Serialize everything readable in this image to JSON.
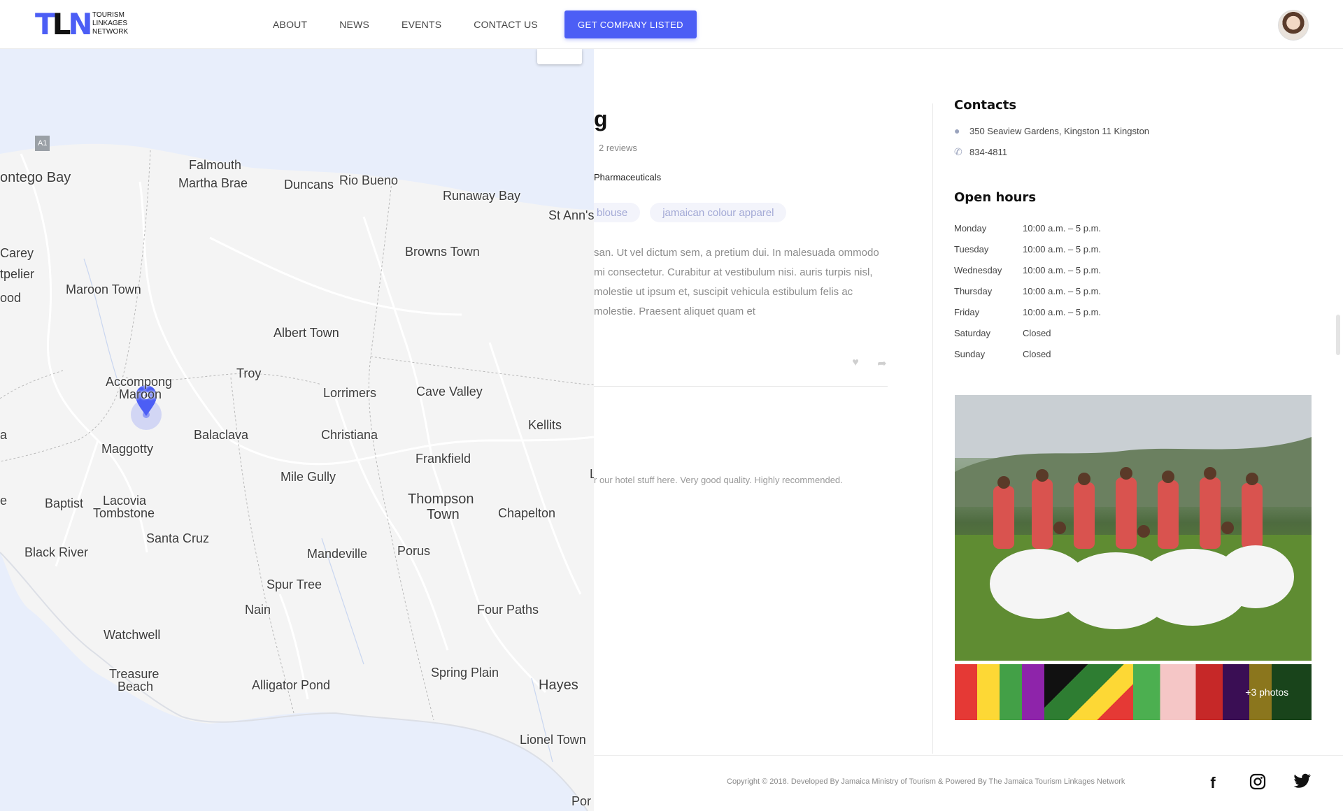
{
  "header": {
    "logo_mark": {
      "t": "T",
      "l": "L",
      "n": "N"
    },
    "logo_text": [
      "TOURISM",
      "LINKAGES",
      "NETWORK"
    ],
    "nav": [
      "ABOUT",
      "NEWS",
      "EVENTS",
      "CONTACT US"
    ],
    "cta": "GET COMPANY LISTED"
  },
  "map": {
    "route_badge": "A1",
    "labels": [
      "ontego Bay",
      "Falmouth",
      "Martha Brae",
      "Duncans",
      "Rio Bueno",
      "Runaway Bay",
      "St Ann's",
      "Carey",
      "tpelier",
      "ood",
      "Maroon Town",
      "Browns Town",
      "Albert Town",
      "Troy",
      "Accompong",
      "Maroon",
      "Lorrimers",
      "Cave Valley",
      "Kellits",
      "Balaclava",
      "Christiana",
      "Maggotty",
      "Frankfield",
      "Mile Gully",
      "Baptist",
      "Lacovia",
      "Tombstone",
      "Thompson",
      "Town",
      "Chapelton",
      "Santa Cruz",
      "Black River",
      "Mandeville",
      "Porus",
      "Spur Tree",
      "Nain",
      "Four Paths",
      "Watchwell",
      "Treasure",
      "Beach",
      "Alligator Pond",
      "Spring Plain",
      "Hayes",
      "Lionel Town",
      "Por",
      "a",
      "e",
      "L"
    ],
    "colors": {
      "water": "#e8eefb",
      "land": "#f4f4f4",
      "marker": "#4c5ef5"
    }
  },
  "listing": {
    "title_fragment": "g",
    "reviews": "2 reviews",
    "category": "Pharmaceuticals",
    "tags": [
      "blouse",
      "jamaican colour apparel"
    ],
    "description": "san. Ut vel dictum sem, a pretium dui. In malesuada ommodo mi consectetur. Curabitur at vestibulum nisi. auris turpis nisl, molestie ut ipsum et, suscipit vehicula estibulum felis ac molestie. Praesent aliquet quam et",
    "review_text": "r our hotel stuff here. Very good quality. Highly recommended."
  },
  "sidebar": {
    "contacts_heading": "Contacts",
    "address": "350 Seaview Gardens, Kingston 11 Kingston",
    "phone": "834-4811",
    "hours_heading": "Open hours",
    "hours": [
      {
        "day": "Monday",
        "time": "10:00 a.m. – 5 p.m."
      },
      {
        "day": "Tuesday",
        "time": "10:00 a.m. – 5 p.m."
      },
      {
        "day": "Wednesday",
        "time": "10:00 a.m. – 5 p.m."
      },
      {
        "day": "Thursday",
        "time": "10:00 a.m. – 5 p.m."
      },
      {
        "day": "Friday",
        "time": "10:00 a.m. – 5 p.m."
      },
      {
        "day": "Saturday",
        "time": "Closed"
      },
      {
        "day": "Sunday",
        "time": "Closed"
      }
    ],
    "more_photos": "+3 photos"
  },
  "footer": {
    "copyright": "Copyright © 2018. Developed By Jamaica Ministry of Tourism & Powered By The Jamaica Tourism Linkages Network",
    "socials": [
      "facebook-icon",
      "instagram-icon",
      "twitter-icon"
    ]
  }
}
